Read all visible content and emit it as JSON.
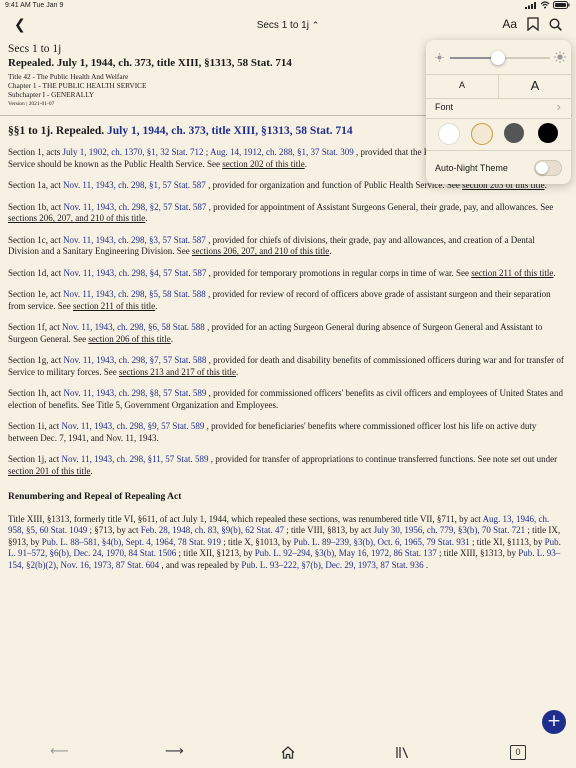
{
  "status_bar": {
    "time_date": "9:41 AM  Tue Jan 9",
    "battery": "100%"
  },
  "navbar": {
    "back_glyph": "❮",
    "title": "Secs 1 to 1j",
    "title_caret": "⌃",
    "font_button": "Aa"
  },
  "header": {
    "crumb": "Secs 1 to 1j",
    "repealed": "Repealed. July 1, 1944, ch. 373, title XIII, §1313, 58 Stat. 714",
    "title_line": "Title 42 - The Public Health And Welfare",
    "chapter_line": "Chapter 1 - THE PUBLIC HEALTH SERVICE",
    "subchapter_line": "Subchapter I - GENERALLY",
    "version": "Version | 2021-01-07"
  },
  "heading": {
    "prefix": "§§1 to 1j. Repealed. ",
    "link": "July 1, 1944, ch. 373, title XIII, §1313, 58 Stat. 714"
  },
  "sections": [
    {
      "pre": "Section 1, acts ",
      "link1": "July 1, 1902, ch. 1370, §1, 32 Stat. 712",
      "mid": " ; ",
      "link2": "Aug. 14, 1912, ch. 288, §1, 37 Stat. 309",
      "text": " , provided that the Public Health and Marine Hospital Service should be known as the Public Health Service. See ",
      "ref": "section 202 of this title",
      "post": "."
    },
    {
      "pre": "Section 1a, act ",
      "link1": "Nov. 11, 1943, ch. 298, §1, 57 Stat. 587",
      "text": " , provided for organization and function of Public Health Service. See ",
      "ref": "section 203 of this title",
      "post": "."
    },
    {
      "pre": "Section 1b, act ",
      "link1": "Nov. 11, 1943, ch. 298, §2, 57 Stat. 587",
      "text": " , provided for appointment of Assistant Surgeons General, their grade, pay, and allowances. See ",
      "ref": "sections 206, 207, and 210 of this title",
      "post": "."
    },
    {
      "pre": "Section 1c, act ",
      "link1": "Nov. 11, 1943, ch. 298, §3, 57 Stat. 587",
      "text": " , provided for chiefs of divisions, their grade, pay and allowances, and creation of a Dental Division and a Sanitary Engineering Division. See ",
      "ref": "sections 206, 207, and 210 of this title",
      "post": "."
    },
    {
      "pre": "Section 1d, act ",
      "link1": "Nov. 11, 1943, ch. 298, §4, 57 Stat. 587",
      "text": " , provided for temporary promotions in regular corps in time of war. See ",
      "ref": "section 211 of this title",
      "post": "."
    },
    {
      "pre": "Section 1e, act ",
      "link1": "Nov. 11, 1943, ch. 298, §5, 58 Stat. 588",
      "text": " , provided for review of record of officers above grade of assistant surgeon and their separation from service. See ",
      "ref": "section 211 of this title",
      "post": "."
    },
    {
      "pre": "Section 1f, act ",
      "link1": "Nov. 11, 1943, ch. 298, §6, 58 Stat. 588",
      "text": " , provided for an acting Surgeon General during absence of Surgeon General and Assistant to Surgeon General. See ",
      "ref": "section 206 of this title",
      "post": "."
    },
    {
      "pre": "Section 1g, act ",
      "link1": "Nov. 11, 1943, ch. 298, §7, 57 Stat. 588",
      "text": " , provided for death and disability benefits of commissioned officers during war and for transfer of Service to military forces. See ",
      "ref": "sections 213 and 217 of this title",
      "post": "."
    },
    {
      "pre": "Section 1h, act ",
      "link1": "Nov. 11, 1943, ch. 298, §8, 57 Stat. 589",
      "text": " , provided for commissioned officers' benefits as civil officers and employees of United States and election of benefits. See Title 5, Government Organization and Employees.",
      "ref": "",
      "post": ""
    },
    {
      "pre": "Section 1i, act ",
      "link1": "Nov. 11, 1943, ch. 298, §9, 57 Stat. 589",
      "text": " , provided for beneficiaries' benefits where commissioned officer lost his life on active duty between Dec. 7, 1941, and Nov. 11, 1943.",
      "ref": "",
      "post": ""
    },
    {
      "pre": "Section 1j, act ",
      "link1": "Nov. 11, 1943, ch. 298, §11, 57 Stat. 589",
      "text": " , provided for transfer of appropriations to continue transferred functions. See note set out under ",
      "ref": "section 201 of this title",
      "post": "."
    }
  ],
  "renumbering": {
    "heading": "Renumbering and Repeal of Repealing Act",
    "t1": "Title XIII, §1313, formerly title VI, §611, of act July 1, 1944, which repealed these sections, was renumbered title VII, §711, by act ",
    "l1": "Aug. 13, 1946, ch. 958, §5, 60 Stat. 1049",
    "t2": " ; §713, by act ",
    "l2": "Feb. 28, 1948, ch. 83, §9(b), 62 Stat. 47",
    "t3": " ; title VIII, §813, by act ",
    "l3": "July 30, 1956, ch. 779, §3(b), 70 Stat. 721",
    "t4": " ; title IX, §913, by ",
    "l4": "Pub. L. 88–581, §4(b), Sept. 4, 1964, 78 Stat. 919",
    "t5": " ; title X, §1013, by ",
    "l5": "Pub. L. 89–239, §3(b), Oct. 6, 1965, 79 Stat. 931",
    "t6": " ; title XI, §1113, by ",
    "l6": "Pub. L. 91–572, §6(b), Dec. 24, 1970, 84 Stat. 1506",
    "t7": " ; title XII, §1213, by ",
    "l7": "Pub. L. 92–294, §3(b), May 16, 1972, 86 Stat. 137",
    "t8": " ; title XIII, §1313, by ",
    "l8": "Pub. L. 93–154, §2(b)(2), Nov. 16, 1973, 87 Stat. 604",
    "t9": " , and was repealed by ",
    "l9": "Pub. L. 93–222, §7(b), Dec. 29, 1973, 87 Stat. 936",
    "t10": " ."
  },
  "display_panel": {
    "brightness_level": 0.48,
    "font_size_small": "A",
    "font_size_large": "A",
    "font_label": "Font",
    "font_chevron": "›",
    "themes": [
      {
        "name": "white",
        "color": "#ffffff",
        "selected": false
      },
      {
        "name": "sepia",
        "color": "#f3e9d2",
        "selected": true
      },
      {
        "name": "gray",
        "color": "#555555",
        "selected": false
      },
      {
        "name": "black",
        "color": "#000000",
        "selected": false
      }
    ],
    "auto_night_label": "Auto-Night Theme",
    "auto_night_on": false
  },
  "fab": {
    "label": "+"
  },
  "toolbar": {
    "back": "⟵",
    "forward": "⟶",
    "tab_count": "0"
  },
  "colors": {
    "background": "#f7f1e3",
    "link": "#1f2e8c",
    "accent": "#1f2e8c"
  }
}
